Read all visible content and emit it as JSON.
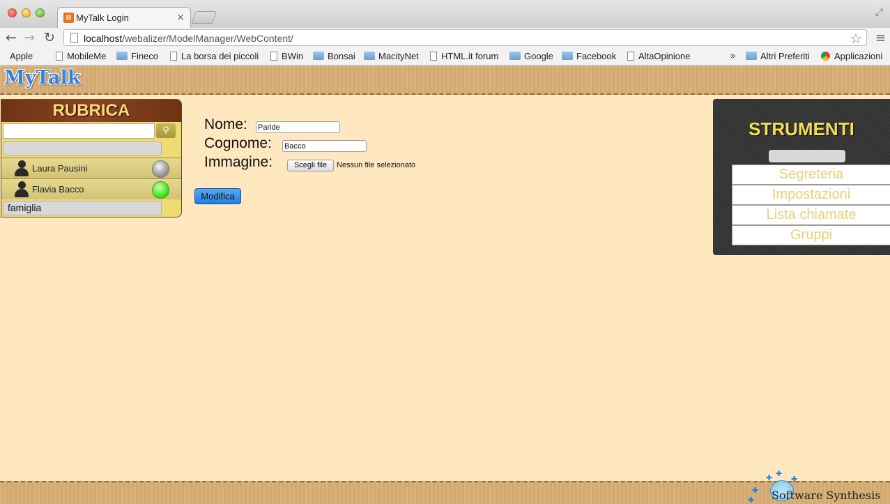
{
  "browser": {
    "tab_title": "MyTalk Login",
    "tab_close": "×",
    "url_host": "localhost",
    "url_path": "/webalizer/ModelManager/WebContent/",
    "bookmarks": [
      {
        "label": "Apple",
        "icon": "apple-icon"
      },
      {
        "label": "MobileMe",
        "icon": "page-icon"
      },
      {
        "label": "Fineco",
        "icon": "folder-icon"
      },
      {
        "label": "La borsa dei piccoli",
        "icon": "page-icon"
      },
      {
        "label": "BWin",
        "icon": "page-icon"
      },
      {
        "label": "Bonsai",
        "icon": "folder-icon"
      },
      {
        "label": "MacityNet",
        "icon": "folder-icon"
      },
      {
        "label": "HTML.it forum",
        "icon": "page-icon"
      },
      {
        "label": "Google",
        "icon": "folder-icon"
      },
      {
        "label": "Facebook",
        "icon": "folder-icon"
      },
      {
        "label": "AltaOpinione",
        "icon": "page-icon"
      }
    ],
    "bookmarks_overflow": "»",
    "other_bookmarks": "Altri Preferiti",
    "apps": "Applicazioni"
  },
  "app": {
    "logo": "MyTalk"
  },
  "rubrica": {
    "title": "RUBRICA",
    "search_value": "",
    "contacts": [
      {
        "name": "Laura Pausini",
        "status": "offline"
      },
      {
        "name": "Flavia Bacco",
        "status": "online"
      }
    ],
    "group": "famiglia"
  },
  "form": {
    "nome_label": "Nome:",
    "nome_value": "Paride",
    "cognome_label": "Cognome:",
    "cognome_value": "Bacco",
    "immagine_label": "Immagine:",
    "file_button": "Scegli file",
    "file_status": "Nessun file selezionato",
    "submit": "Modifica"
  },
  "strumenti": {
    "title": "STRUMENTI",
    "items": [
      "Segreteria",
      "Impostazioni",
      "Lista chiamate",
      "Gruppi"
    ]
  },
  "footer": {
    "brand": "Software Synthesis"
  },
  "colors": {
    "page_bg": "#ffe7bf",
    "rubrica_title_bg": "#6e3314",
    "strumenti_text": "#f2dc5a",
    "button_blue": "#1f7fe0"
  }
}
